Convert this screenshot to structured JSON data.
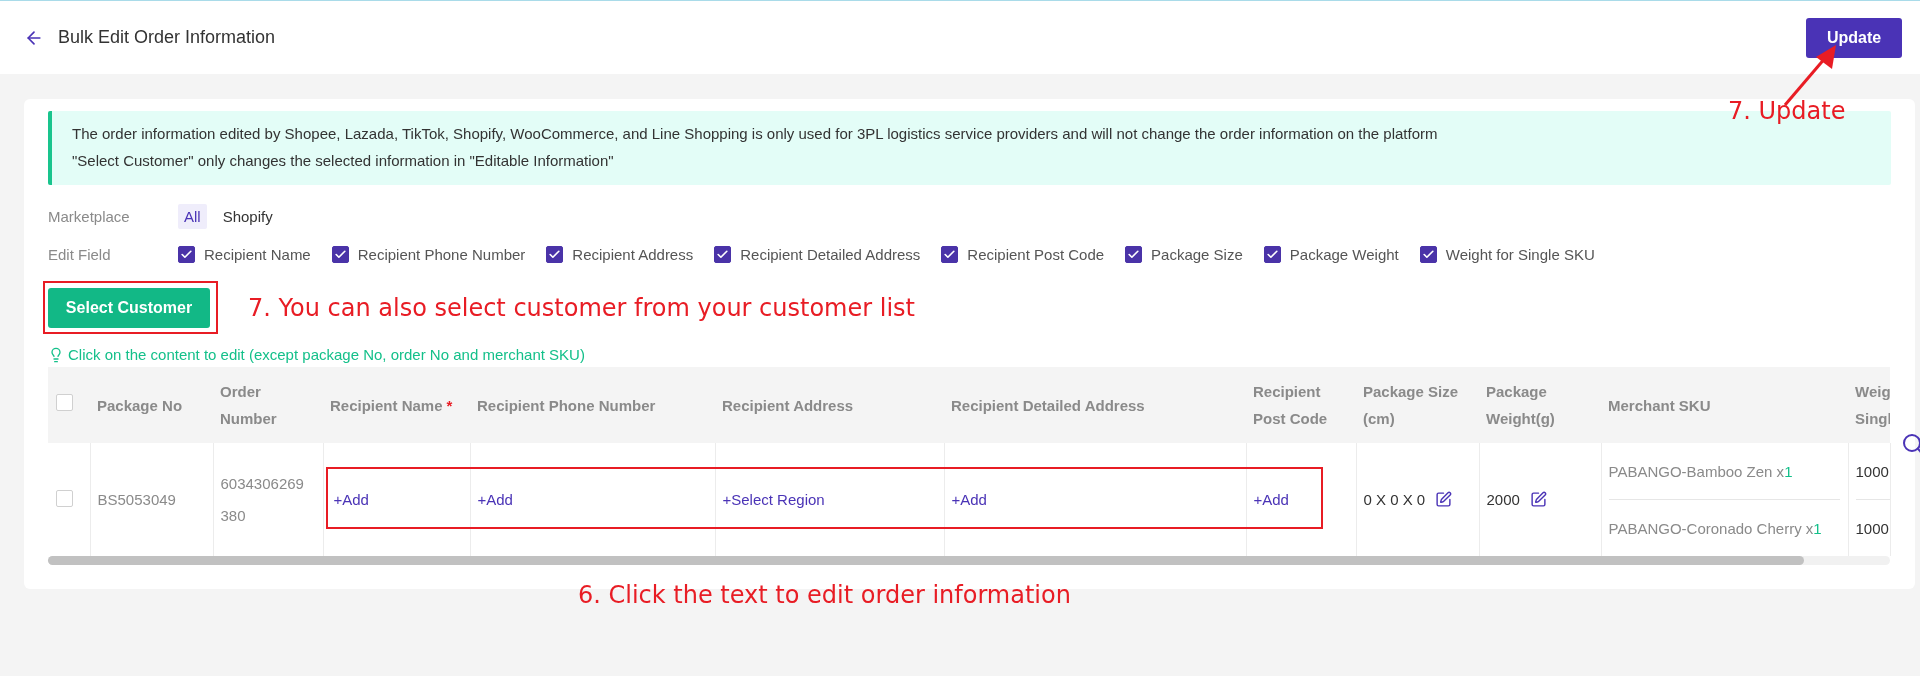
{
  "header": {
    "title": "Bulk Edit Order Information",
    "update_button": "Update"
  },
  "notice": {
    "lines": [
      "The order information edited by Shopee, Lazada, TikTok, Shopify, WooCommerce, and Line Shopping is only used for 3PL logistics service providers and will not change the order information on the platform",
      "\"Select Customer\" only changes the selected information in \"Editable Information\""
    ]
  },
  "marketplace": {
    "label": "Marketplace",
    "options": [
      {
        "label": "All",
        "selected": true
      },
      {
        "label": "Shopify",
        "selected": false
      }
    ]
  },
  "edit_field": {
    "label": "Edit Field",
    "options": [
      {
        "label": "Recipient Name",
        "checked": true
      },
      {
        "label": "Recipient Phone Number",
        "checked": true
      },
      {
        "label": "Recipient Address",
        "checked": true
      },
      {
        "label": "Recipient Detailed Address",
        "checked": true
      },
      {
        "label": "Recipient Post Code",
        "checked": true
      },
      {
        "label": "Package Size",
        "checked": true
      },
      {
        "label": "Package Weight",
        "checked": true
      },
      {
        "label": "Weight for Single SKU",
        "checked": true
      }
    ]
  },
  "select_customer_button": "Select Customer",
  "hint": "Click on the content to edit (except package No, order No and merchant SKU)",
  "table": {
    "all_checked": false,
    "columns": [
      {
        "label": "Package No"
      },
      {
        "label": "Order Number"
      },
      {
        "label": "Recipient Name",
        "required_mark": "*"
      },
      {
        "label": "Recipient Phone Number"
      },
      {
        "label": "Recipient Address"
      },
      {
        "label": "Recipient Detailed Address"
      },
      {
        "label": "Recipient Post Code"
      },
      {
        "label": "Package Size (cm)"
      },
      {
        "label": "Package Weight(g)"
      },
      {
        "label": "Merchant SKU"
      },
      {
        "label": "Weig Singl"
      }
    ],
    "rows": [
      {
        "selected": false,
        "cells": [
          {
            "kind": "text",
            "text": "BS5053049"
          },
          {
            "kind": "number",
            "text": "6034306269380"
          },
          {
            "kind": "link",
            "text": "+Add"
          },
          {
            "kind": "link",
            "text": "+Add"
          },
          {
            "kind": "link",
            "text": "+Select Region"
          },
          {
            "kind": "link",
            "text": "+Add"
          },
          {
            "kind": "link",
            "text": "+Add"
          },
          {
            "kind": "edit",
            "text": "0 X 0 X 0"
          },
          {
            "kind": "edit",
            "text": "2000"
          },
          {
            "kind": "sku",
            "items": [
              {
                "name": "PABANGO-Bamboo Zen x",
                "qty": "1"
              },
              {
                "name": "PABANGO-Coronado Cherry x",
                "qty": "1"
              }
            ]
          },
          {
            "kind": "stack",
            "items": [
              "1000",
              "1000"
            ]
          }
        ]
      }
    ]
  },
  "annotations": [
    {
      "text": "7. Update"
    },
    {
      "text": "7. You can also select customer from your customer list"
    },
    {
      "text": "6. Click the text to edit order information"
    }
  ]
}
